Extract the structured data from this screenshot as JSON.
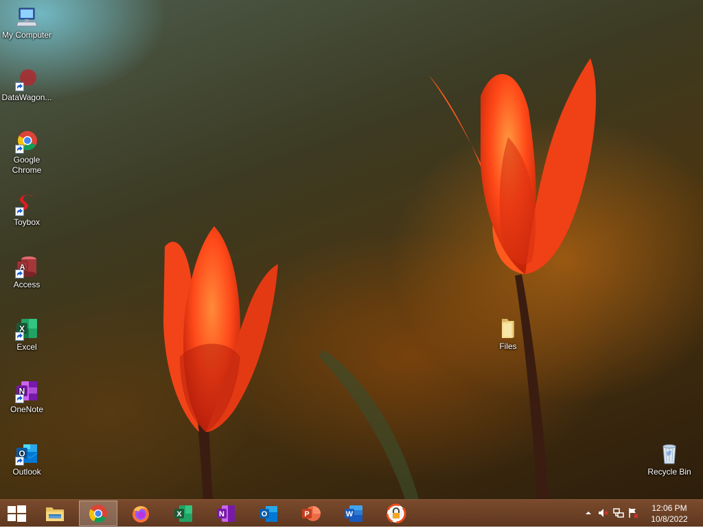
{
  "desktop": {
    "icons": [
      {
        "label": "My Computer"
      },
      {
        "label": "DataWagon..."
      },
      {
        "label": "Google Chrome"
      },
      {
        "label": "Toybox"
      },
      {
        "label": "Access"
      },
      {
        "label": "Excel"
      },
      {
        "label": "OneNote"
      },
      {
        "label": "Outlook"
      },
      {
        "label": "Files"
      },
      {
        "label": "Recycle Bin"
      }
    ]
  },
  "taskbar": {
    "pinned": [
      {
        "name": "windows-start-icon"
      },
      {
        "name": "file-explorer-icon"
      },
      {
        "name": "google-chrome-icon",
        "active": true
      },
      {
        "name": "firefox-icon"
      },
      {
        "name": "excel-icon"
      },
      {
        "name": "onenote-icon"
      },
      {
        "name": "outlook-icon"
      },
      {
        "name": "powerpoint-icon"
      },
      {
        "name": "word-icon"
      },
      {
        "name": "vpn-lock-icon"
      }
    ],
    "tray": {
      "icons": [
        "show-hidden-icons-chevron-icon",
        "volume-muted-icon",
        "network-icon",
        "action-center-flag-icon"
      ],
      "time": "12:06 PM",
      "date": "10/8/2022"
    }
  },
  "colors": {
    "taskbar": "#6a3f24",
    "icon_text": "#ffffff",
    "wallpaper_tulip": "#ff4a1a"
  }
}
